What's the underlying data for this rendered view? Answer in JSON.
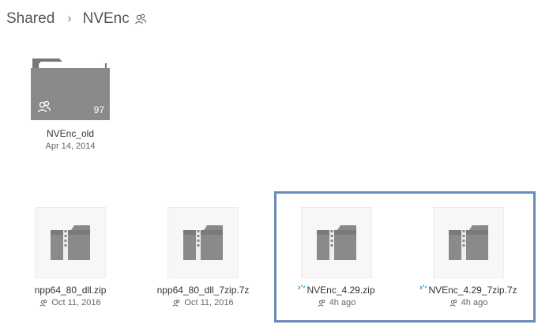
{
  "breadcrumb": {
    "root": "Shared",
    "current": "NVEnc"
  },
  "colors": {
    "selection_border": "#6a8ab7",
    "folder_body": "#8a8a8a",
    "sync_icon": "#1e8fd6"
  },
  "folders": [
    {
      "name": "NVEnc_old",
      "date": "Apr 14, 2014",
      "count": "97",
      "shared": true
    }
  ],
  "files": [
    {
      "name": "npp64_80_dll.zip",
      "date": "Oct 11, 2016",
      "icon": "zip-file-icon",
      "syncing": false,
      "selected": false
    },
    {
      "name": "npp64_80_dll_7zip.7z",
      "date": "Oct 11, 2016",
      "icon": "zip-file-icon",
      "syncing": false,
      "selected": false
    },
    {
      "name": "NVEnc_4.29.zip",
      "date": "4h ago",
      "icon": "zip-file-icon",
      "syncing": true,
      "selected": true
    },
    {
      "name": "NVEnc_4.29_7zip.7z",
      "date": "4h ago",
      "icon": "zip-file-icon",
      "syncing": true,
      "selected": true
    }
  ]
}
